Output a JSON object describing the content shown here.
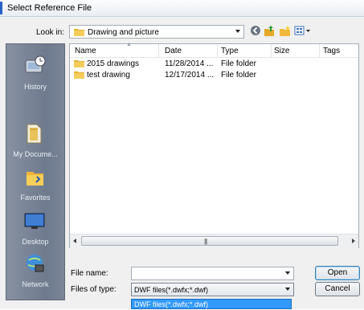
{
  "window": {
    "title": "Select Reference File",
    "accent_color": "#2a63c4"
  },
  "lookin": {
    "label": "Look in:",
    "value": "Drawing and picture"
  },
  "toolbar": {
    "icons": [
      "back-icon",
      "up-folder-icon",
      "new-folder-icon",
      "views-menu-icon"
    ]
  },
  "places": [
    {
      "label": "History",
      "icon": "history-icon"
    },
    {
      "label": "My Docume...",
      "icon": "my-documents-icon"
    },
    {
      "label": "Favorites",
      "icon": "favorites-icon"
    },
    {
      "label": "Desktop",
      "icon": "desktop-icon"
    },
    {
      "label": "Network",
      "icon": "network-icon"
    }
  ],
  "list": {
    "columns": [
      "Name",
      "Date",
      "Type",
      "Size",
      "Tags"
    ],
    "rows": [
      {
        "name": "2015 drawings",
        "date": "11/28/2014 ...",
        "type": "File folder",
        "size": "",
        "tags": ""
      },
      {
        "name": "test drawing",
        "date": "12/17/2014 ...",
        "type": "File folder",
        "size": "",
        "tags": ""
      }
    ]
  },
  "filename": {
    "label": "File name:",
    "value": ""
  },
  "filetype": {
    "label": "Files of type:",
    "value": "DWF files(*.dwfx;*.dwf)",
    "dropdown_option": "DWF files(*.dwfx;*.dwf)"
  },
  "buttons": {
    "open": "Open",
    "cancel": "Cancel"
  },
  "colors": {
    "selection": "#3399ff",
    "places_bg": "#7b8698"
  }
}
